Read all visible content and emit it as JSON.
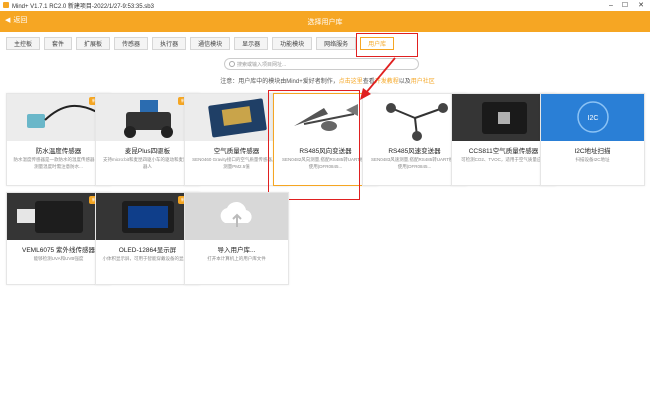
{
  "window": {
    "title": "Mind+ V1.7.1 RC2.0   新建项目-2022/1/27-9:53:35.sb3"
  },
  "header": {
    "back_label": "返回",
    "title": "选择用户库"
  },
  "tabs": [
    {
      "label": "主控板"
    },
    {
      "label": "套件"
    },
    {
      "label": "扩展板"
    },
    {
      "label": "传感器"
    },
    {
      "label": "执行器"
    },
    {
      "label": "通信模块"
    },
    {
      "label": "显示器"
    },
    {
      "label": "功能模块"
    },
    {
      "label": "网络服务"
    },
    {
      "label": "用户库"
    }
  ],
  "search": {
    "placeholder": "搜索或输入项目网址..."
  },
  "notice": {
    "prefix": "注意：用户库中的模块由Mind+爱好者制作，",
    "link1": "点击这里",
    "middle": "查看",
    "link2": "开发教程",
    "and": "以及",
    "link3": "用户社区"
  },
  "cards": [
    {
      "name": "防水温度传感器",
      "desc": "防水温度传感器是一款防水的温度传感器，在测量温度时需注意防水...",
      "badge": "新功能"
    },
    {
      "name": "麦昆Plus四驱板",
      "desc": "支持micro:bit和麦昆四驱小车的驱动和麦昆机器人",
      "badge": "新功能"
    },
    {
      "name": "空气质量传感器",
      "desc": "SEN0460 Gravity接口的空气质量传感器，可测量PM2.5值",
      "badge": ""
    },
    {
      "name": "RS485风向变送器",
      "desc": "SEN0482风向测量,搭配RS485转UART模块使用(DFR0845...",
      "badge": ""
    },
    {
      "name": "RS485风速变送器",
      "desc": "SEN0483风速测量,搭配RS485转UART模块使用(DFR0845...",
      "badge": ""
    },
    {
      "name": "CCS811空气质量传感器",
      "desc": "可检测CO2、TVOC，适用于空气质量应用",
      "badge": ""
    },
    {
      "name": "I2C地址扫描",
      "desc": "扫描设备I2C地址",
      "badge": ""
    },
    {
      "name": "VEML6075 紫外线传感器",
      "desc": "能够检测UVA和UVB强度",
      "badge": "新功能"
    },
    {
      "name": "OLED-12864显示屏",
      "desc": "小体积显示屏，可用于智能穿戴设备的显示器",
      "badge": "新功能"
    },
    {
      "name": "导入用户库...",
      "desc": "打开本计算机上的用户库文件",
      "badge": ""
    }
  ],
  "colors": {
    "accent": "#f6a623",
    "highlight": "#e02020"
  }
}
